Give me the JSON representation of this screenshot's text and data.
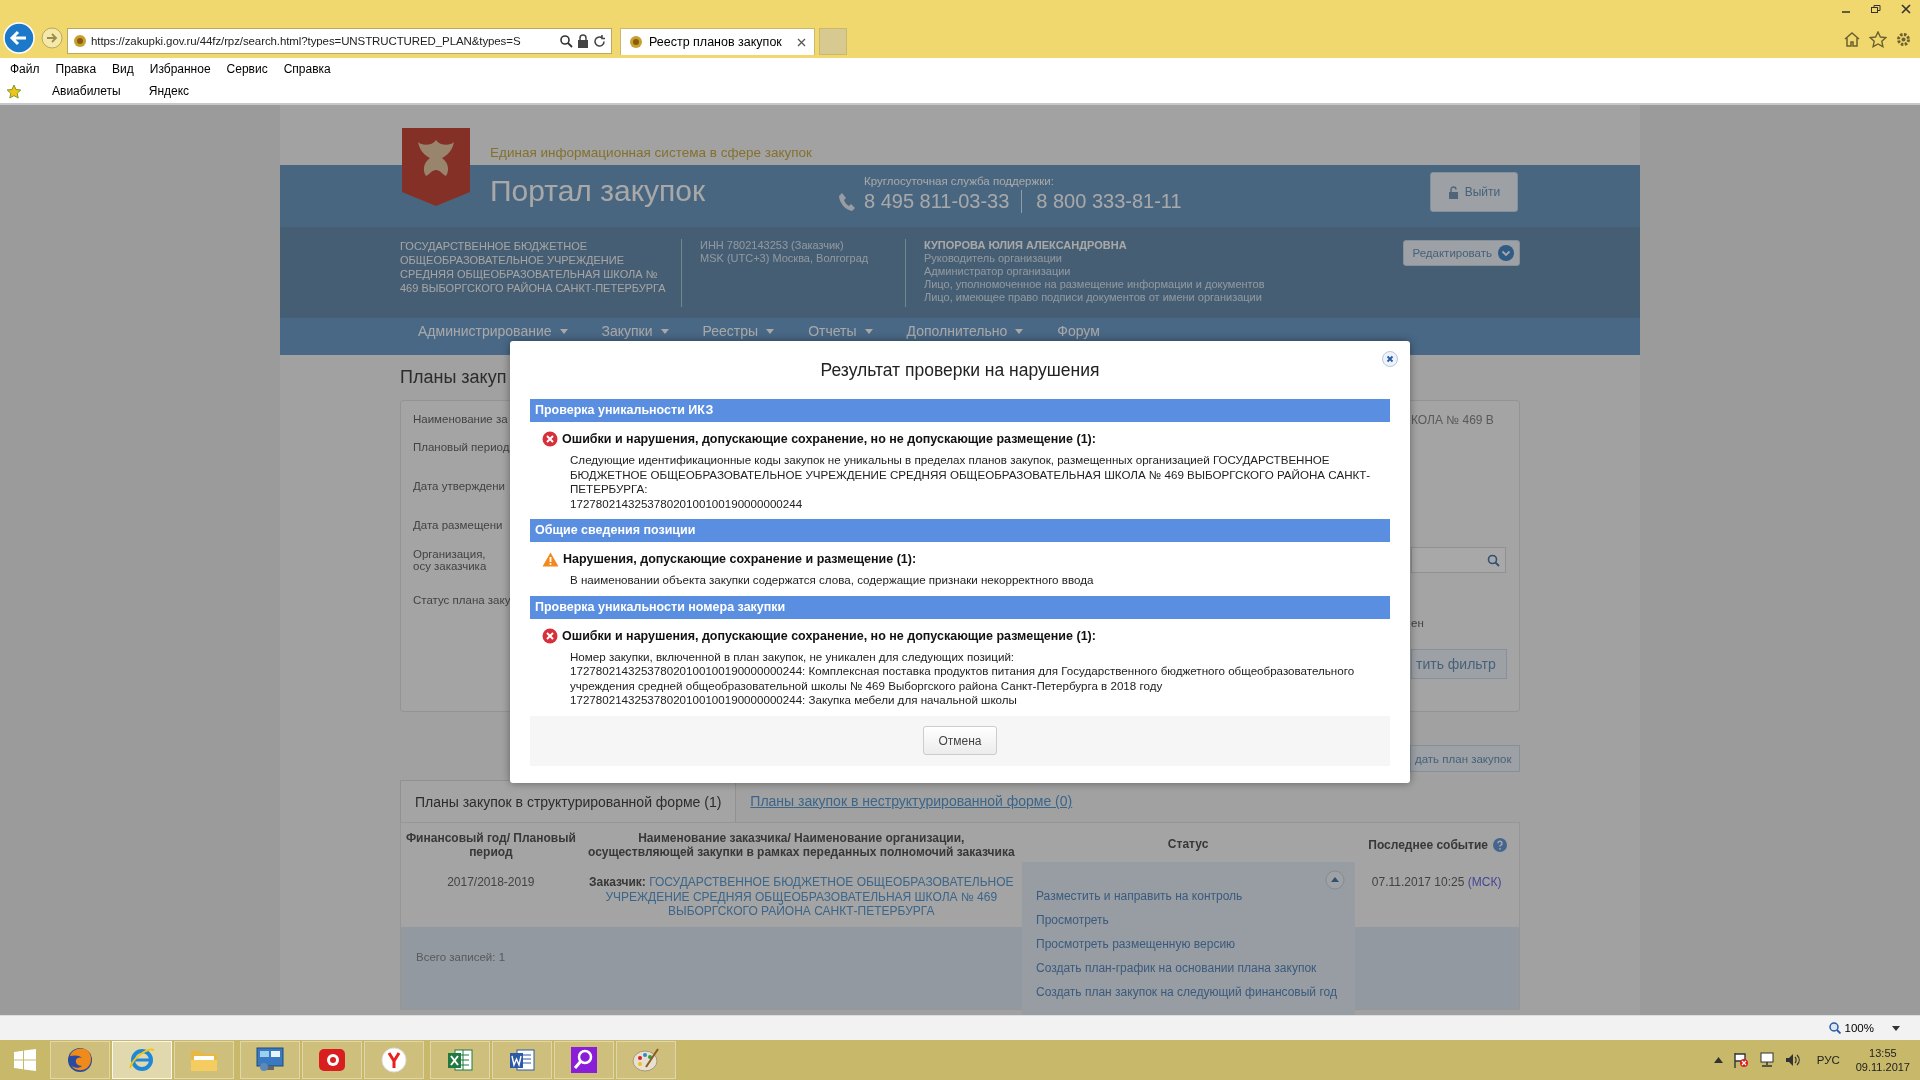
{
  "browser": {
    "url": "https://zakupki.gov.ru/44fz/rpz/search.html?types=UNSTRUCTURED_PLAN&types=S",
    "tabs": [
      {
        "label": "Реестр планов закупок",
        "selected": true
      }
    ],
    "menu": [
      "Файл",
      "Правка",
      "Вид",
      "Избранное",
      "Сервис",
      "Справка"
    ],
    "favorites": [
      "Авиабилеты",
      "Яндекс"
    ],
    "zoom": "100%"
  },
  "header": {
    "tagline": "Единая информационная система в сфере закупок",
    "title": "Портал закупок",
    "support_label": "Круглосуточная служба поддержки:",
    "phones": [
      "8 495 811-03-33",
      "8 800 333-81-11"
    ],
    "logout": "Выйти",
    "org_lines": [
      "ГОСУДАРСТВЕННОЕ БЮДЖЕТНОЕ",
      "ОБЩЕОБРАЗОВАТЕЛЬНОЕ УЧРЕЖДЕНИЕ",
      "СРЕДНЯЯ ОБЩЕОБРАЗОВАТЕЛЬНАЯ ШКОЛА №",
      "469 ВЫБОРГСКОГО РАЙОНА САНКТ-ПЕТЕРБУРГА"
    ],
    "org_details": [
      "ИНН 7802143253 (Заказчик)",
      "MSK (UTC+3) Москва, Волгоград"
    ],
    "user_name": "КУПОРОВА ЮЛИЯ АЛЕКСАНДРОВНА",
    "user_roles": [
      "Руководитель организации",
      "Администратор организации",
      "Лицо, уполномоченное на размещение информации и документов",
      "Лицо, имеющее право подписи документов от имени организации"
    ],
    "edit_button": "Редактировать"
  },
  "nav": [
    "Администрирование",
    "Закупки",
    "Реестры",
    "Отчеты",
    "Дополнительно",
    "Форум"
  ],
  "page_title": "Планы закуп",
  "filter": {
    "labels": [
      "Наименование за",
      "Плановый период",
      "Дата утверждени",
      "Дата размещени",
      "Организация, осу заказчика",
      "Статус плана заку"
    ],
    "customer_value": "КОЛА № 469 В",
    "status_value": "ен",
    "apply_button": "тить фильтр",
    "create_button": "дать план закупок"
  },
  "tabs": [
    {
      "label": "Планы закупок в структурированной форме (1)",
      "selected": true
    },
    {
      "label": "Планы закупок в неструктурированной форме (0)",
      "selected": false
    }
  ],
  "table": {
    "columns": [
      "Финансовый год/ Плановый период",
      "Наименование заказчика/ Наименование организации, осуществляющей закупки в рамках переданных полномочий заказчика",
      "Статус",
      "Последнее событие"
    ],
    "rows": [
      {
        "period": "2017/2018-2019",
        "customer_label": "Заказчик:",
        "customer": "ГОСУДАРСТВЕННОЕ БЮДЖЕТНОЕ ОБЩЕОБРАЗОВАТЕЛЬНОЕ УЧРЕЖДЕНИЕ СРЕДНЯЯ ОБЩЕОБРАЗОВАТЕЛЬНАЯ ШКОЛА № 469 ВЫБОРГСКОГО РАЙОНА САНКТ-ПЕТЕРБУРГА",
        "event": "07.11.2017 10:25",
        "timezone": "(МСК)"
      }
    ],
    "total": "Всего записей: 1"
  },
  "actions_menu": [
    "Разместить и направить на контроль",
    "Просмотреть",
    "Просмотреть размещенную версию",
    "Создать план-график на основании плана закупок",
    "Создать план закупок на следующий финансовый год"
  ],
  "modal": {
    "title": "Результат проверки на нарушения",
    "sections": [
      {
        "header": "Проверка уникальности ИКЗ",
        "kind": "error",
        "issue": "Ошибки и нарушения, допускающие сохранение, но не допускающие размещение (1):",
        "lines": [
          "Следующие идентификационные коды закупок не уникальны в пределах планов закупок, размещенных организацией ГОСУДАРСТВЕННОЕ БЮДЖЕТНОЕ ОБЩЕОБРАЗОВАТЕЛЬНОЕ УЧРЕЖДЕНИЕ СРЕДНЯЯ ОБЩЕОБРАЗОВАТЕЛЬНАЯ ШКОЛА № 469 ВЫБОРГСКОГО РАЙОНА САНКТ-ПЕТЕРБУРГА:",
          "172780214325378020100100190000000244"
        ]
      },
      {
        "header": "Общие сведения позиции",
        "kind": "warning",
        "issue": "Нарушения, допускающие сохранение и размещение (1):",
        "lines": [
          "В наименовании объекта закупки содержатся слова, содержащие признаки некорректного ввода"
        ]
      },
      {
        "header": "Проверка уникальности номера закупки",
        "kind": "error",
        "issue": "Ошибки и нарушения, допускающие сохранение, но не допускающие размещение (1):",
        "lines": [
          "Номер закупки, включенной в план закупок, не уникален для следующих позиций:",
          "172780214325378020100100190000000244: Комплексная поставка продуктов питания для Государственного бюджетного общеобразовательного учреждения средней общеобразовательной школы № 469 Выборгского района Санкт-Петербурга в 2018 году",
          "172780214325378020100100190000000244: Закупка мебели для начальной школы"
        ]
      }
    ],
    "cancel": "Отмена"
  },
  "taskbar": {
    "apps": [
      {
        "kind": "firefox",
        "selected": false
      },
      {
        "kind": "ie",
        "selected": true
      },
      {
        "kind": "explorer",
        "selected": false
      },
      {
        "kind": "monitor",
        "selected": false
      },
      {
        "kind": "record",
        "selected": false
      },
      {
        "kind": "yandex",
        "selected": false
      },
      {
        "kind": "excel",
        "selected": false
      },
      {
        "kind": "word",
        "selected": false
      },
      {
        "kind": "search",
        "selected": false
      },
      {
        "kind": "paint",
        "selected": false
      }
    ],
    "language": "РУС",
    "time": "13:55",
    "date": "09.11.2017"
  }
}
